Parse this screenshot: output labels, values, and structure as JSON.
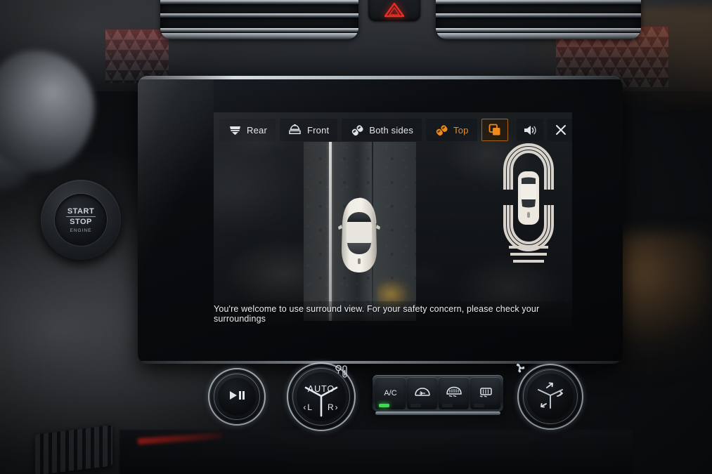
{
  "screen": {
    "toolbar": {
      "items": [
        {
          "id": "rear",
          "label": "Rear",
          "icon": "car-rear-icon",
          "state": "inactive"
        },
        {
          "id": "front",
          "label": "Front",
          "icon": "car-front-icon",
          "state": "inactive"
        },
        {
          "id": "both_sides",
          "label": "Both sides",
          "icon": "both-sides-icon",
          "state": "inactive"
        },
        {
          "id": "top",
          "label": "Top",
          "icon": "top-view-icon",
          "state": "active"
        }
      ],
      "layers_button": {
        "id": "layers",
        "icon": "layers-icon",
        "state": "selected"
      },
      "volume_button": {
        "id": "volume",
        "icon": "speaker-icon",
        "state": "inactive"
      },
      "close_button": {
        "id": "close",
        "icon": "close-icon",
        "state": "inactive"
      }
    },
    "warning_text": "You're welcome to use surround view. For your safety concern, please check your surroundings",
    "views": {
      "main_view_label": "surround-top-view",
      "side_panel_label": "parking-sensor-radar"
    },
    "colors": {
      "accent_orange": "#ef8a1b",
      "text_primary": "#e2e6ea",
      "panel_bg": "#101419"
    }
  },
  "physical_controls": {
    "start_stop": {
      "line1": "START",
      "line2": "STOP",
      "line3": "ENGINE"
    },
    "media_knob": {
      "icon": "play-pause-icon"
    },
    "climate_knob": {
      "auto_label": "AUTO",
      "left_label": "‹L",
      "right_label": "R›",
      "badge_icon": "temperature-icon"
    },
    "fan_knob": {
      "icon": "airflow-direction-icon"
    },
    "climate_bar": [
      {
        "id": "ac",
        "label": "A/C",
        "icon": "",
        "led": "on"
      },
      {
        "id": "recirculate",
        "label": "",
        "icon": "recirculation-icon",
        "led": "off"
      },
      {
        "id": "front_defrost",
        "label": "",
        "icon": "front-defrost-icon",
        "led": "off"
      },
      {
        "id": "rear_defrost",
        "label": "",
        "icon": "rear-defrost-icon",
        "led": "off"
      }
    ],
    "hazard_button": {
      "icon": "hazard-triangle-icon",
      "color": "#ff2a1e"
    }
  },
  "dashboard": {
    "vent_left_label": "air-vent-left",
    "vent_right_label": "air-vent-right",
    "mesh_label": "honeycomb-trim",
    "ambient_color": "#d22a24"
  }
}
